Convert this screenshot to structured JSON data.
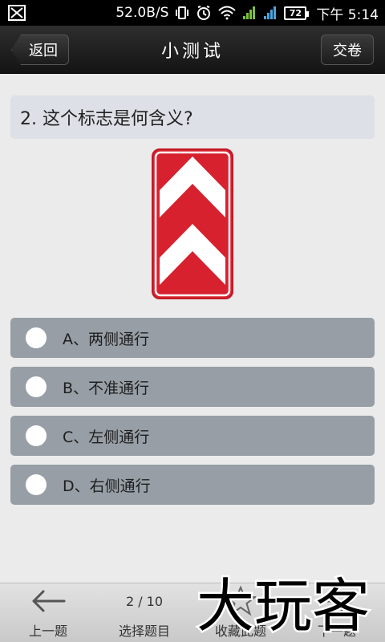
{
  "status_bar": {
    "network_speed": "52.0B/S",
    "battery": "72",
    "time": "下午 5:14"
  },
  "header": {
    "back_label": "返回",
    "title": "小测试",
    "submit_label": "交卷"
  },
  "question": {
    "text": "2. 这个标志是何含义?"
  },
  "options": [
    {
      "label": "A、两侧通行"
    },
    {
      "label": "B、不准通行"
    },
    {
      "label": "C、左侧通行"
    },
    {
      "label": "D、右侧通行"
    }
  ],
  "bottom_bar": {
    "prev_label": "上一题",
    "progress": "2 / 10",
    "select_label": "选择题目",
    "favorite_label": "收藏此题",
    "next_label": "下一题"
  },
  "watermark": {
    "text": "大玩客"
  },
  "colors": {
    "sign_red": "#d7212e",
    "option_bg": "#979ea6",
    "question_bg": "#dde0e6"
  }
}
